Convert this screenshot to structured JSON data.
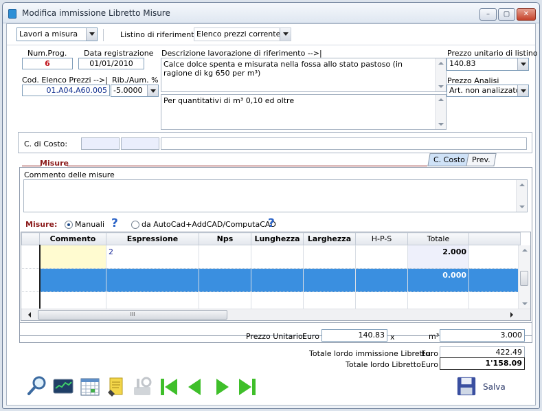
{
  "window": {
    "title": "Modifica immissione Libretto Misure",
    "minimize": "–",
    "restore": "▢",
    "close": "✕"
  },
  "top": {
    "tipo_lavori": "Lavori a misura",
    "listino_label": "Listino di riferimento:",
    "listino_value": "Elenco prezzi corrente"
  },
  "record": {
    "num_prog_label": "Num.Prog.",
    "num_prog": "6",
    "data_label": "Data registrazione",
    "data": "01/01/2010",
    "cod_label": "Cod. Elenco Prezzi -->|",
    "cod": "01.A04.A60.005",
    "rib_label": "Rib./Aum. %",
    "rib": "-5.0000",
    "descr_label": "Descrizione lavorazione di riferimento -->|",
    "descr": "Calce dolce spenta e misurata nella fossa allo stato pastoso (in ragione di kg 650 per m³)",
    "descr2": "Per quantitativi di m³ 0,10 ed oltre",
    "prezzo_listino_label": "Prezzo unitario di listino",
    "prezzo_listino": "140.83",
    "prezzo_analisi_label": "Prezzo Analisi",
    "prezzo_analisi": "Art. non analizzato"
  },
  "costo": {
    "label": "C. di Costo:"
  },
  "misure": {
    "section_title": "Misure",
    "tab_costo": "C. Costo",
    "tab_prev": "Prev.",
    "commento_label": "Commento delle misure",
    "commento": "",
    "misure_label": "Misure:",
    "opt_manuali": "Manuali",
    "opt_autocad": "da AutoCad+AddCAD/ComputaCAD",
    "help": "?"
  },
  "grid": {
    "columns": [
      "Commento",
      "Espressione",
      "Nps",
      "Lunghezza",
      "Larghezza",
      "H-P-S",
      "Totale"
    ],
    "rows": [
      {
        "commento": "",
        "espressione": "2",
        "nps": "",
        "lunghezza": "",
        "larghezza": "",
        "hps": "",
        "totale": "2.000"
      },
      {
        "commento": "",
        "espressione": "",
        "nps": "",
        "lunghezza": "",
        "larghezza": "",
        "hps": "",
        "totale": "0.000"
      }
    ],
    "hscroll_grip": "III"
  },
  "footer": {
    "prezzo_unitario_label": "Prezzo Unitario:",
    "euro": "Euro",
    "prezzo_unitario": "140.83",
    "x": "x",
    "unit": "m³",
    "quantita": "3.000",
    "tot_immissione_label": "Totale lordo immissione Libretto:",
    "tot_immissione": "422.49",
    "tot_libretto_label": "Totale lordo Libretto:",
    "tot_libretto": "1'158.09"
  },
  "toolbar": {
    "icons": [
      "search-icon",
      "monitor-icon",
      "calendar-grid-icon",
      "notes-icon",
      "tools-icon",
      "first-record-icon",
      "previous-record-icon",
      "next-record-icon",
      "last-record-icon"
    ],
    "save_label": "Salva"
  },
  "colors": {
    "accent": "#8b1a1a",
    "selection": "#3a8fe0",
    "nav_green": "#3fbf2a",
    "totale_col": "#eef0fb",
    "commento_col": "#fffbd0"
  }
}
